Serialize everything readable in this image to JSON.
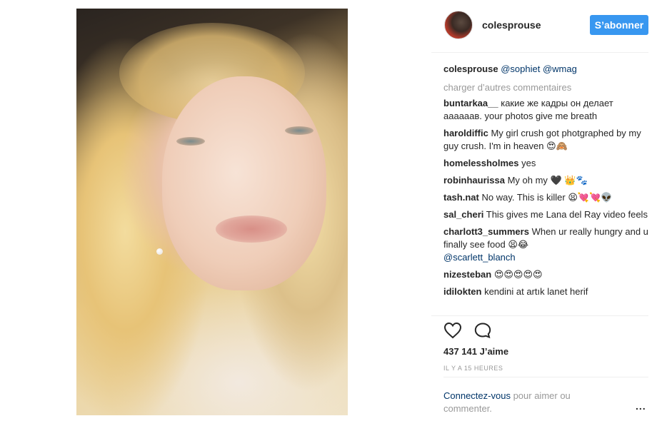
{
  "post": {
    "author": "colesprouse",
    "follow_label": "S’abonner",
    "caption": {
      "user": "colesprouse",
      "mentions": [
        "@sophiet",
        "@wmag"
      ]
    },
    "load_more_label": "charger d’autres commentaires",
    "comments": [
      {
        "user": "buntarkaa__",
        "text": "какие же кадры он делает аааааав. your photos give me breath"
      },
      {
        "user": "haroldiffic",
        "text": "My girl crush got photgraphed by my guy crush. I'm in heaven 😍🙈"
      },
      {
        "user": "homelessholmes",
        "text": "yes"
      },
      {
        "user": "robinhaurissa",
        "text": "My oh my 🖤 👑🐾"
      },
      {
        "user": "tash.nat",
        "text": "No way. This is killer 😫💘💘👽"
      },
      {
        "user": "sal_cheri",
        "text": "This gives me Lana del Ray video feels"
      },
      {
        "user": "charlott3_summers",
        "text": "When ur really hungry and u finally see food 😫😂 ",
        "mention": "@scarlett_blanch"
      },
      {
        "user": "nizesteban",
        "text": "😍😍😍😍😍"
      },
      {
        "user": "idilokten",
        "text": "kendini at artık lanet herif"
      }
    ],
    "likes_label": "437 141 J’aime",
    "timestamp": "IL Y A 15 HEURES",
    "login_prompt": {
      "link": "Connectez-vous",
      "rest": " pour aimer ou commenter."
    },
    "more_label": "..."
  },
  "icons": {
    "like": "heart-icon",
    "comment": "comment-icon",
    "more": "more-options-icon"
  },
  "colors": {
    "accent": "#3897f0",
    "link": "#003569",
    "muted": "#999999"
  }
}
